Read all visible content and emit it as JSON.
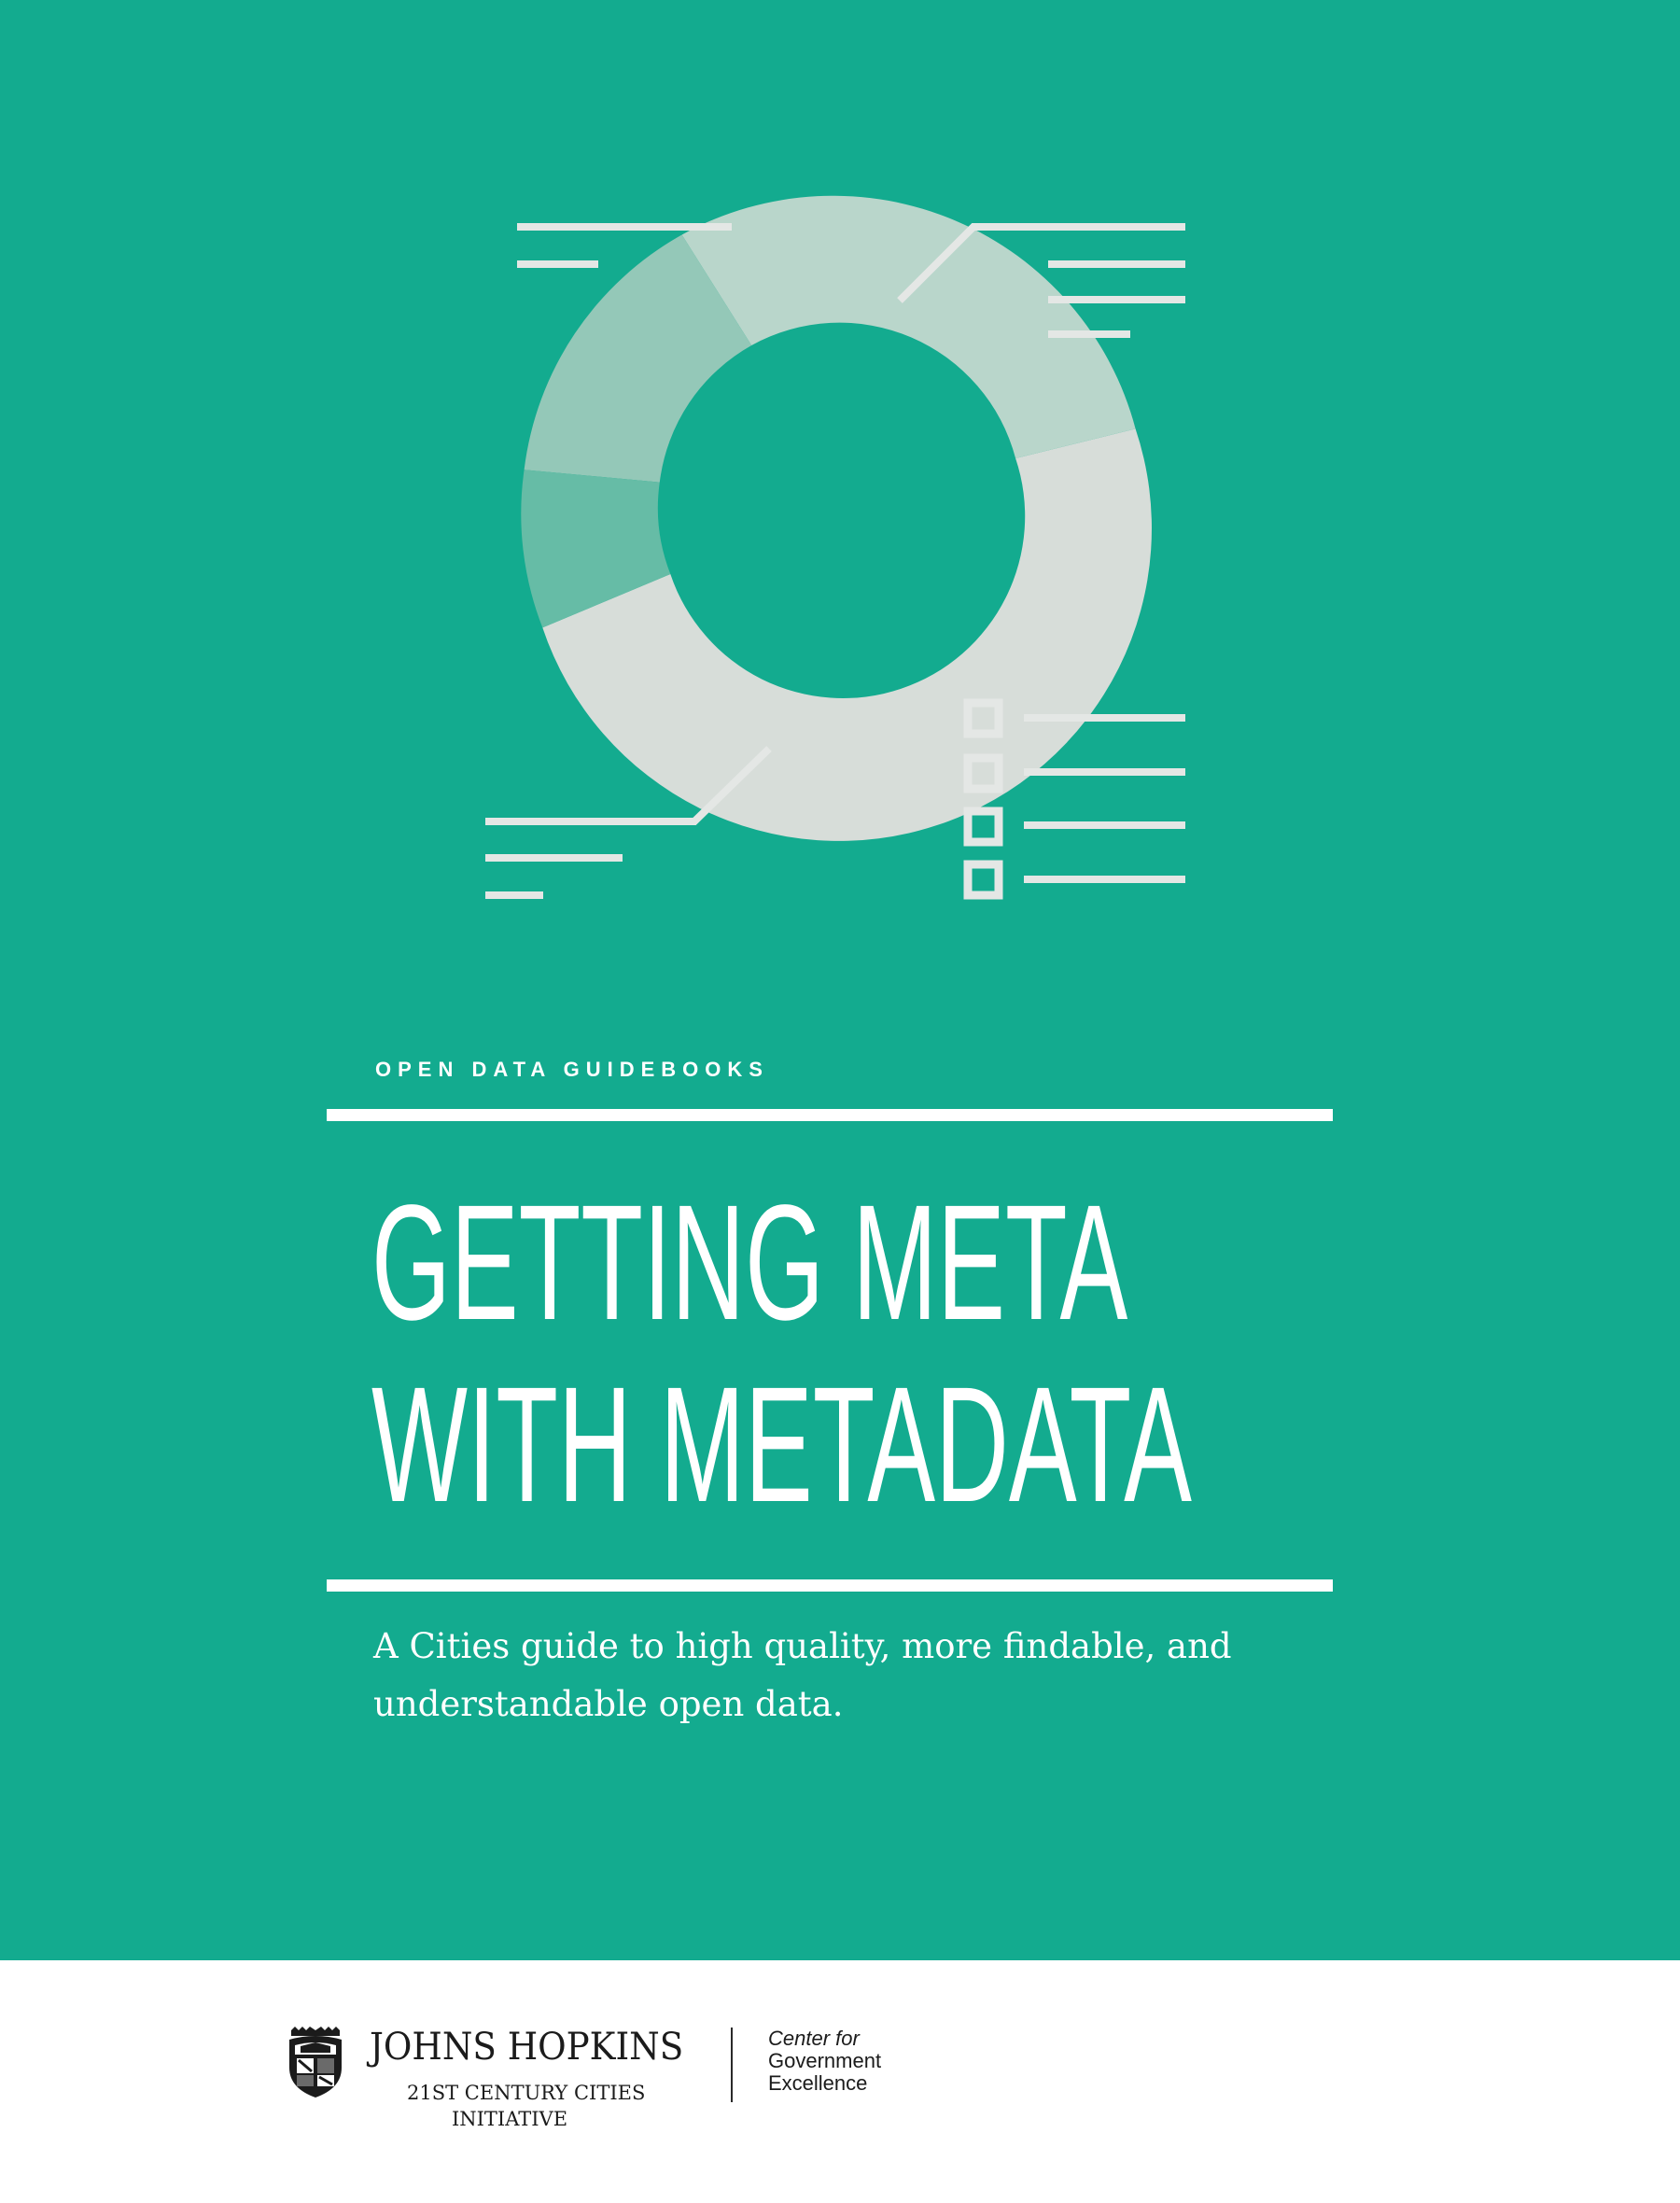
{
  "cover": {
    "series_label": "OPEN DATA GUIDEBOOKS",
    "title_lines": [
      "GETTING META",
      "WITH METADATA"
    ],
    "subtitle_lines": [
      "A Cities guide to high quality, more findable, and",
      "understandable open data."
    ],
    "colors": {
      "background": "#13ab8f",
      "text": "#ffffff",
      "ring_light": "#d7ddd9",
      "ring_mint": "#b9d6cb",
      "ring_medium": "#94c8b8",
      "ring_dark": "#66bca6",
      "illustration_lines": "#e4e7e5"
    },
    "illustration": {
      "description_icon": "donut-chart-icon",
      "checkbox_count": 4
    }
  },
  "footer": {
    "jhu": {
      "shield_icon": "jhu-shield-icon",
      "name": "JOHNS HOPKINS",
      "initiative_line_1": "21ST CENTURY CITIES",
      "initiative_line_2": "INITIATIVE"
    },
    "cge": {
      "line_1": "Center for",
      "line_2": "Government",
      "line_3": "Excellence"
    }
  }
}
